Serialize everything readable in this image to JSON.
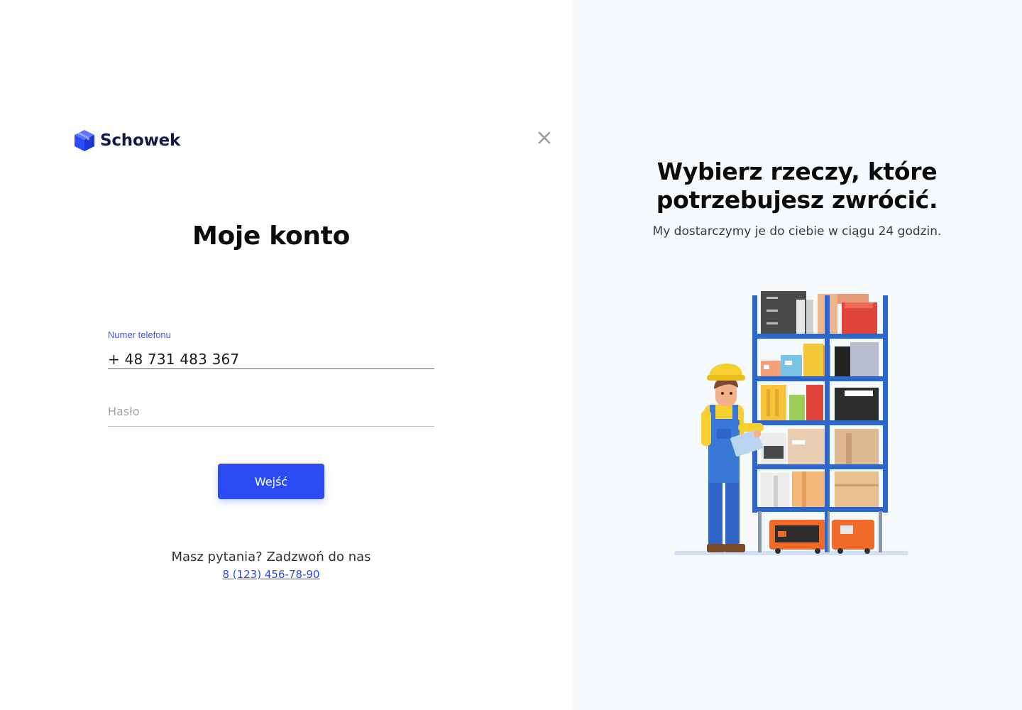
{
  "brand": {
    "name": "Schowek",
    "accent_color": "#2b4bf5",
    "logo_icon": "box-3d-icon"
  },
  "header": {
    "close_icon": "close-icon"
  },
  "login": {
    "title": "Moje konto",
    "phone": {
      "label": "Numer telefonu",
      "value": "+ 48 731 483 367"
    },
    "password": {
      "placeholder": "Hasło",
      "value": ""
    },
    "submit_label": "Wejść"
  },
  "help": {
    "text": "Masz pytania? Zadzwoń do nas",
    "phone_link": "8 (123) 456-78-90"
  },
  "promo": {
    "title_line1": "Wybierz rzeczy, które",
    "title_line2": "potrzebujesz zwrócić.",
    "subtitle": "My dostarczymy je do ciebie w ciągu 24 godzin.",
    "illustration": "warehouse-worker-with-shelves-illustration"
  }
}
